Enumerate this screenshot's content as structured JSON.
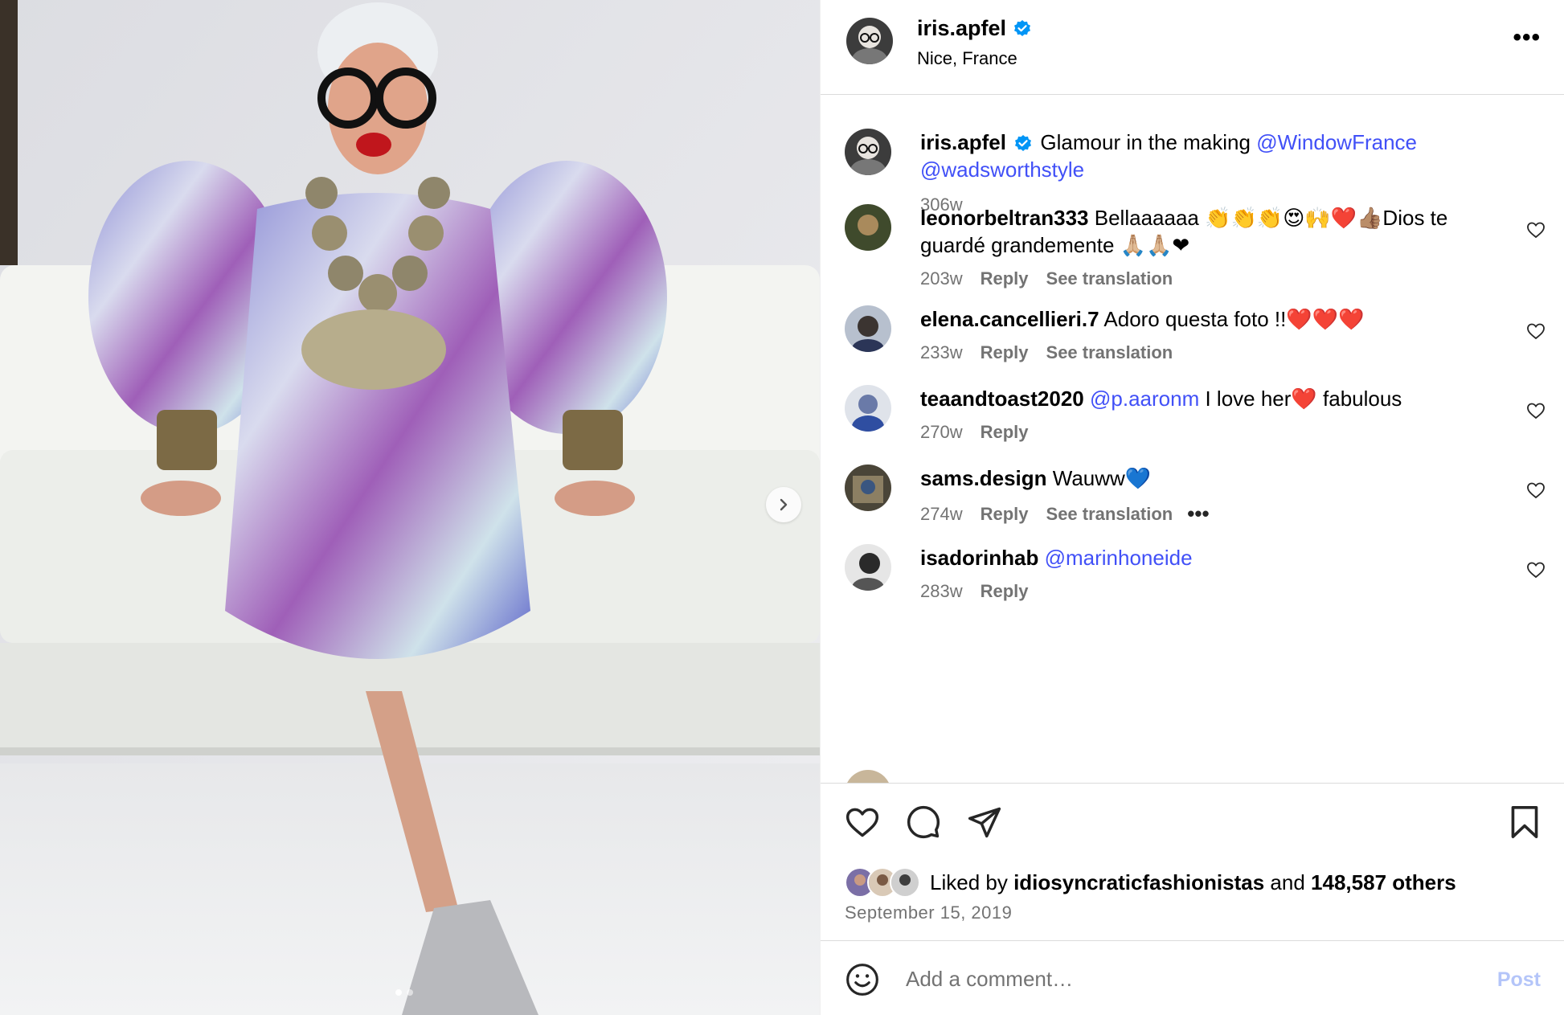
{
  "post": {
    "author": "iris.apfel",
    "location": "Nice, France",
    "more_label": "•••"
  },
  "caption": {
    "author": "iris.apfel",
    "text": "Glamour in the making",
    "mention1": "@WindowFrance",
    "mention2": "@wadsworthstyle",
    "age": "306w"
  },
  "comments": [
    {
      "user": "leonorbeltran333",
      "text": "Bellaaaaaa 👏👏👏😍🙌❤️👍🏽Dios te guardé grandemente 🙏🏼🙏🏼❤",
      "age": "203w",
      "reply": "Reply",
      "translate": "See translation"
    },
    {
      "user": "elena.cancellieri.7",
      "text": "Adoro questa foto !!❤️❤️❤️",
      "age": "233w",
      "reply": "Reply",
      "translate": "See translation"
    },
    {
      "user": "teaandtoast2020",
      "mention": "@p.aaronm",
      "text": "I love her❤️ fabulous",
      "age": "270w",
      "reply": "Reply"
    },
    {
      "user": "sams.design",
      "text": "Wauww💙",
      "age": "274w",
      "reply": "Reply",
      "translate": "See translation",
      "more": "•••"
    },
    {
      "user": "isadorinhab",
      "mention": "@marinhoneide",
      "age": "283w",
      "reply": "Reply"
    }
  ],
  "likes": {
    "prefix": "Liked by",
    "user": "idiosyncraticfashionistas",
    "and": "and",
    "count": "148,587 others"
  },
  "date": "September 15, 2019",
  "composer": {
    "placeholder": "Add a comment…",
    "post_label": "Post"
  },
  "colors": {
    "verified": "#0095f6",
    "mention": "#4150f7",
    "muted": "#737373",
    "post_disabled": "#b4c5f9"
  },
  "carousel": {
    "current": 1,
    "total": 2
  }
}
